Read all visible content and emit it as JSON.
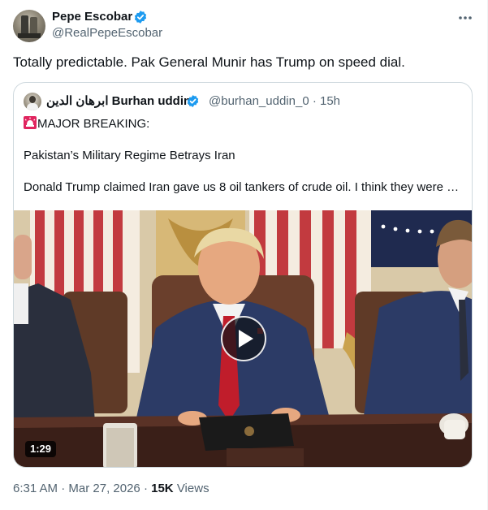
{
  "tweet": {
    "author_name": "Pepe Escobar",
    "author_handle": "@RealPepeEscobar",
    "text": "Totally predictable. Pak General Munir has Trump on speed dial.",
    "more_icon": "more-horizontal-icon"
  },
  "quote": {
    "author_name": "ابرهان الدين Burhan uddin",
    "author_handle": "@burhan_uddin_0 · 15h",
    "headline": "MAJOR BREAKING:",
    "line_1": "Pakistan’s Military Regime Betrays Iran",
    "line_2": "Donald Trump claimed Iran gave us 8 oil tankers of crude oil. I think they were …",
    "video_duration": "1:29",
    "siren_icon": "police-siren-icon",
    "play_icon": "play-icon"
  },
  "meta": {
    "time": "6:31 AM",
    "separator": "·",
    "date": "Mar 27, 2026",
    "views_count": "15K",
    "views_label": "Views"
  },
  "colors": {
    "verified_blue": "#1d9bf0",
    "text_primary": "#0f1419",
    "text_secondary": "#536471",
    "card_border": "#cfd9de"
  }
}
